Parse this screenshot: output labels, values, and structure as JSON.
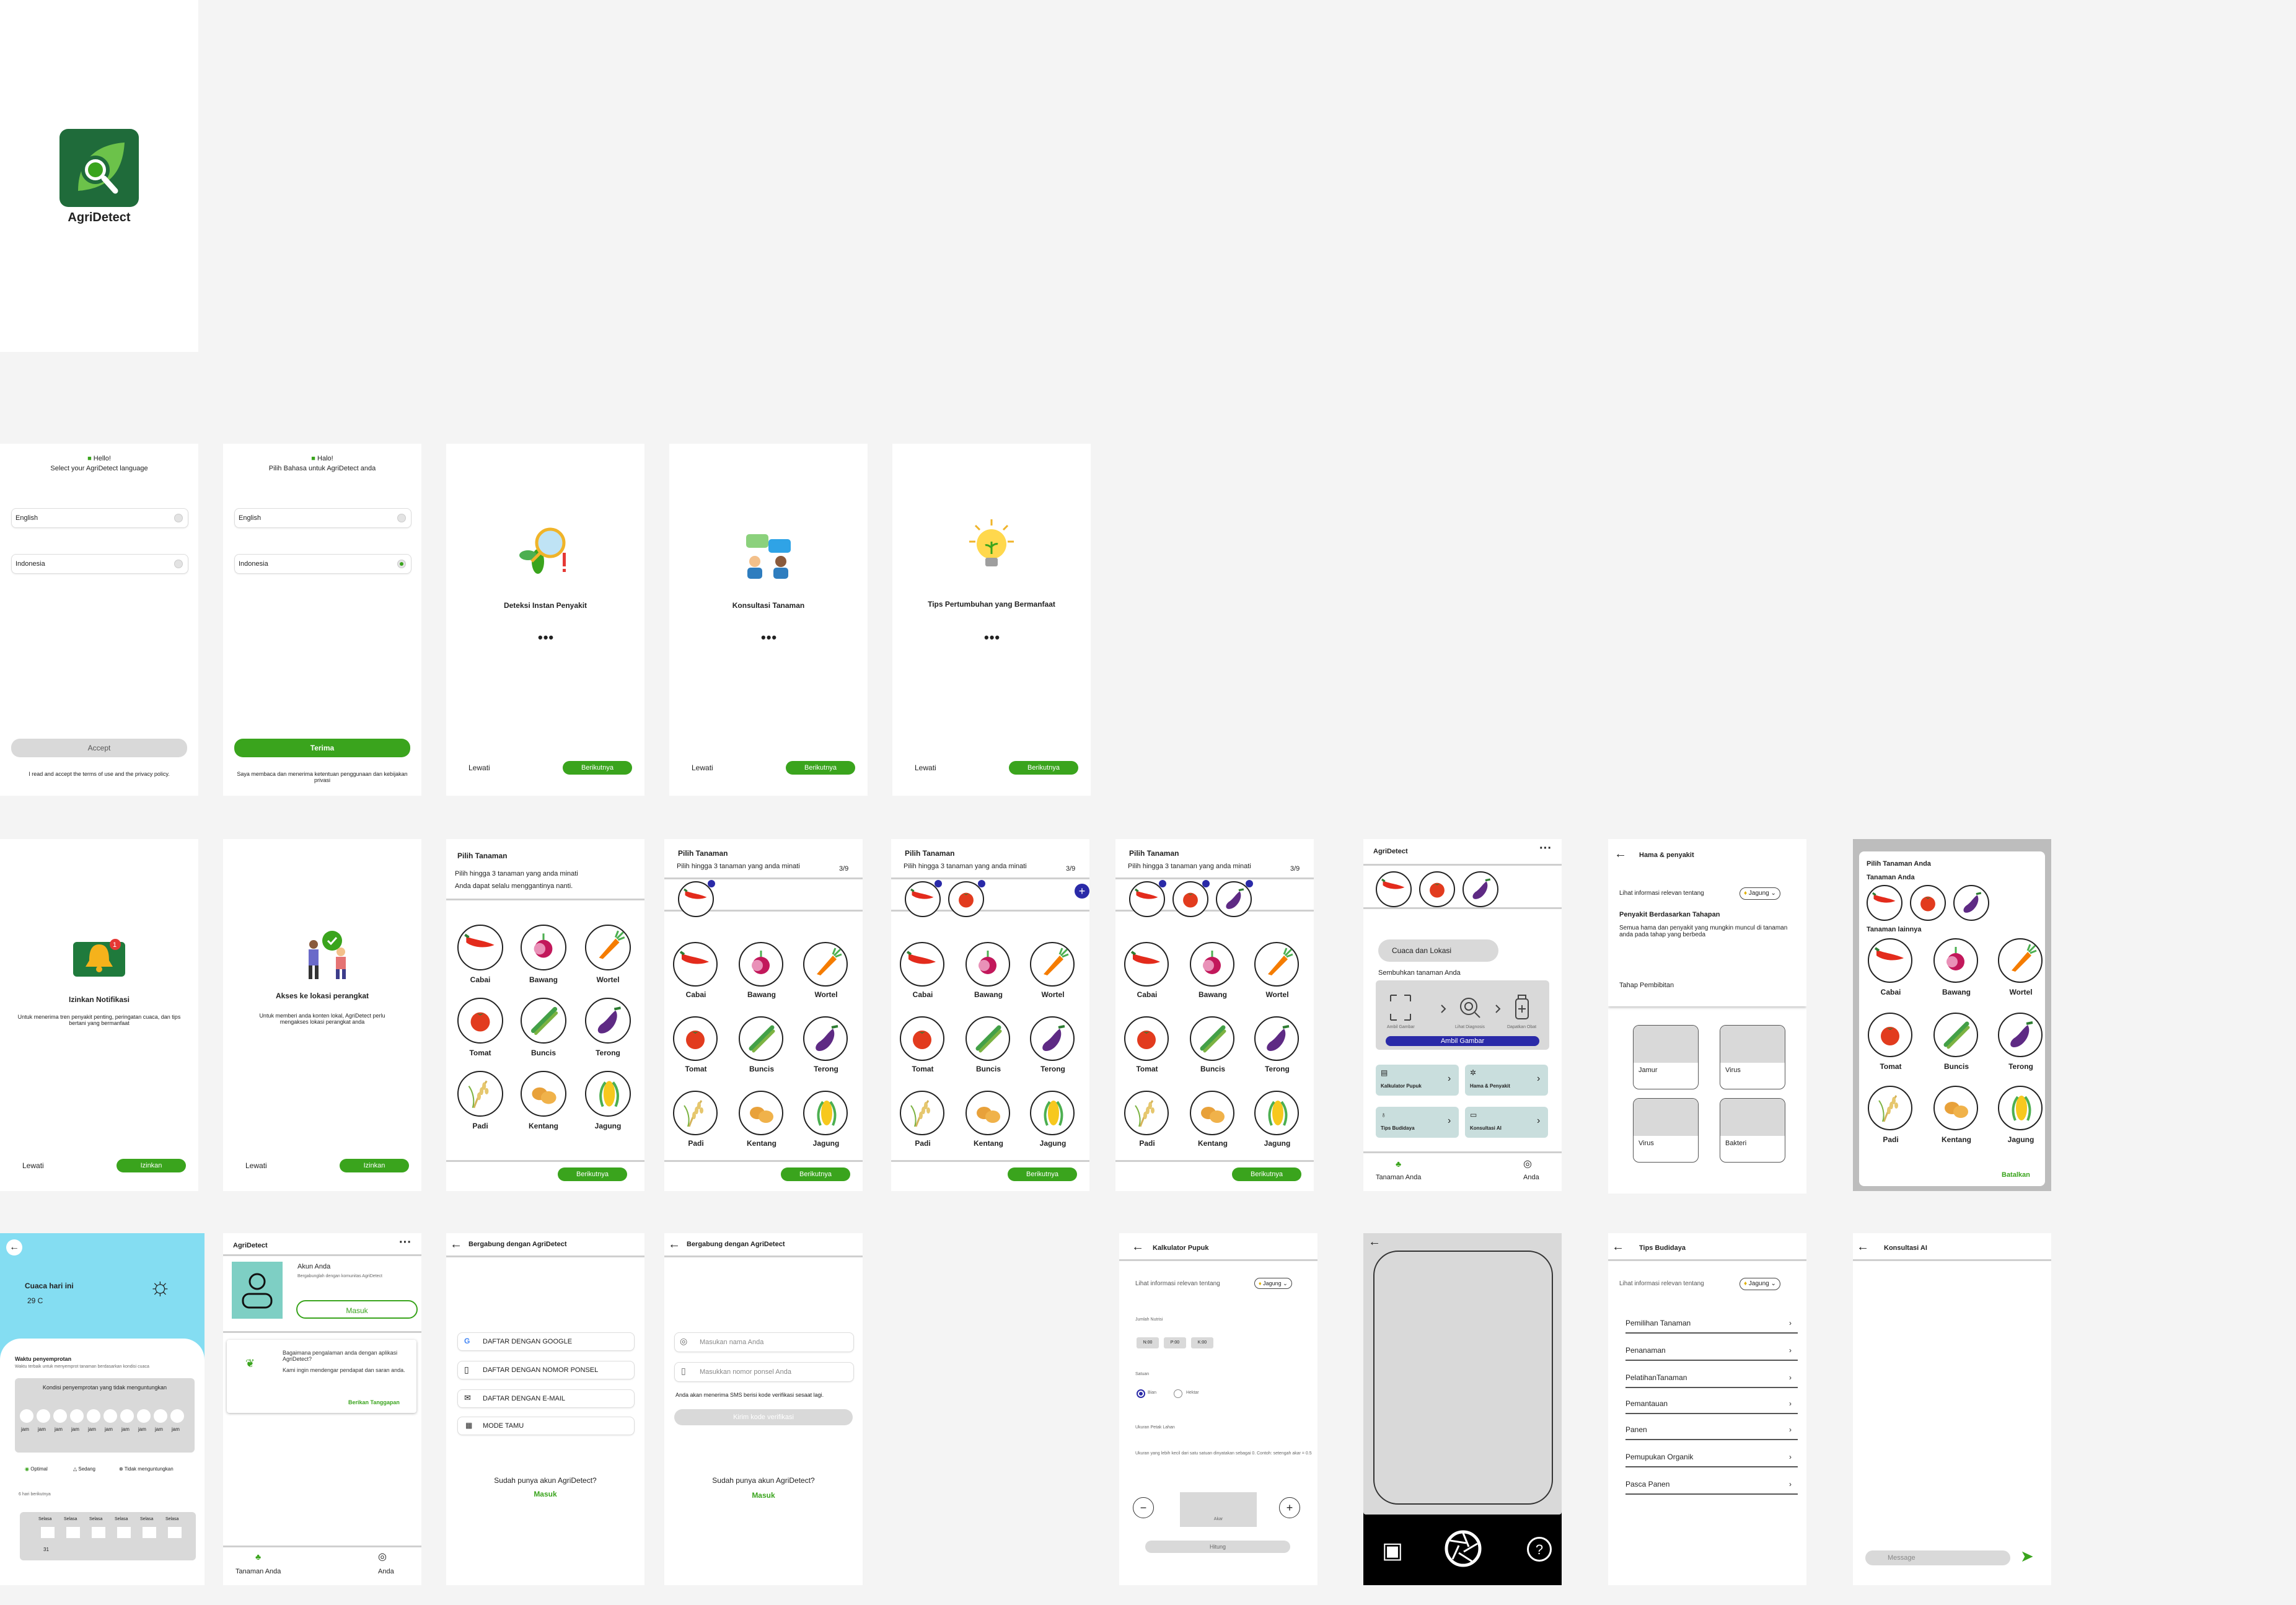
{
  "logo": {
    "app_name": "AgriDetect"
  },
  "lang_en": {
    "hello": "Hello!",
    "prompt": "Select your AgriDetect language",
    "opt1": "English",
    "opt2": "Indonesia",
    "accept": "Accept",
    "terms": "I read and accept the terms of use and the privacy policy."
  },
  "lang_id": {
    "hello": "Halo!",
    "prompt": "Pilih Bahasa untuk AgriDetect anda",
    "opt1": "English",
    "opt2": "Indonesia",
    "accept": "Terima",
    "terms": "Saya membaca dan menerima ketentuan penggunaan dan kebijakan privasi"
  },
  "onboard": [
    {
      "title": "Deteksi Instan Penyakit",
      "skip": "Lewati",
      "next": "Berikutnya"
    },
    {
      "title": "Konsultasi Tanaman",
      "skip": "Lewati",
      "next": "Berikutnya"
    },
    {
      "title": "Tips Pertumbuhan yang Bermanfaat",
      "skip": "Lewati",
      "next": "Berikutnya"
    }
  ],
  "notif": {
    "title": "Izinkan Notifikasi",
    "desc": "Untuk menerima tren penyakit penting, peringatan cuaca, dan tips bertani yang bermanfaat",
    "skip": "Lewati",
    "allow": "Izinkan"
  },
  "loc": {
    "title": "Akses ke lokasi perangkat",
    "desc": "Untuk memberi anda konten lokal, AgriDetect perlu mengakses lokasi perangkat anda",
    "skip": "Lewati",
    "allow": "Izinkan"
  },
  "pick": {
    "title": "Pilih Tanaman",
    "sub1": "Pilih hingga 3 tanaman yang anda minati",
    "sub2": "Anda dapat selalu menggantinya nanti.",
    "count": "3/9",
    "next": "Berikutnya",
    "veg": [
      "Cabai",
      "Bawang",
      "Wortel",
      "Tomat",
      "Buncis",
      "Terong",
      "Padi",
      "Kentang",
      "Jagung"
    ]
  },
  "home": {
    "title": "AgriDetect",
    "weather": "Cuaca dan Lokasi",
    "heal": "Sembuhkan tanaman Anda",
    "step1": "Ambil Gambar",
    "step2": "Lihat Diagnosis",
    "step3": "Dapatkan Obat",
    "take": "Ambil Gambar",
    "c1": "Kalkulator Pupuk",
    "c2": "Hama & Penyakit",
    "c3": "Tips Budidaya",
    "c4": "Konsultasi AI",
    "nav1": "Tanaman Anda",
    "nav2": "Anda"
  },
  "pest": {
    "title": "Hama & penyakit",
    "see": "Lihat informasi relevan tentang",
    "crop": "Jagung",
    "h": "Penyakit Berdasarkan Tahapan",
    "desc": "Semua hama dan penyakit yang mungkin muncul di tanaman anda pada tahap yang berbeda",
    "stage": "Tahap Pembibitan",
    "cards": [
      "Jamur",
      "Virus",
      "Virus",
      "Bakteri"
    ]
  },
  "modal": {
    "title": "Pilih Tanaman Anda",
    "mine": "Tanaman Anda",
    "other": "Tanaman lainnya",
    "cancel": "Batalkan"
  },
  "weather": {
    "title": "Cuaca hari ini",
    "temp": "29  C",
    "spray": "Waktu penyemprotan",
    "spray_desc": "Waktu terbaik untuk menyemprot tanaman berdasarkan kondisi cuaca",
    "cond": "Kondisi penyemprotan yang tidak menguntungkan",
    "hour": "jam",
    "lg1": "Optimal",
    "lg2": "Sedang",
    "lg3": "Tidak menguntungkan",
    "next6": "6 hari berikutnya",
    "day": "Selasa",
    "d31": "31"
  },
  "account": {
    "title": "AgriDetect",
    "acc": "Akun Anda",
    "join": "Bergabunglah dengan komunitas AgriDetect",
    "login": "Masuk",
    "q": "Bagaimana pengalaman anda dengan aplikasi AgriDetect?",
    "fb": "Kami ingin mendengar pendapat dan saran anda.",
    "give": "Berikan Tanggapan",
    "nav1": "Tanaman Anda",
    "nav2": "Anda"
  },
  "join": {
    "title": "Bergabung dengan AgriDetect",
    "g": "DAFTAR DENGAN GOOGLE",
    "p": "DAFTAR DENGAN NOMOR PONSEL",
    "e": "DAFTAR DENGAN E-MAIL",
    "m": "MODE TAMU",
    "have": "Sudah punya akun AgriDetect?",
    "login": "Masuk"
  },
  "join2": {
    "title": "Bergabung dengan AgriDetect",
    "name": "Masukan nama Anda",
    "phone": "Masukkan nomor ponsel Anda",
    "sms": "Anda akan menerima SMS berisi kode verifikasi sesaat lagi.",
    "send": "Kirim kode verifikasi",
    "have": "Sudah punya akun AgriDetect?",
    "login": "Masuk"
  },
  "calc": {
    "title": "Kalkulator Pupuk",
    "see": "Lihat informasi relevan tentang",
    "crop": "Jagung",
    "nut": "Jumlah Nutrisi",
    "chips": [
      "N:00",
      "P:00",
      "K:00"
    ],
    "unit": "Satuan",
    "u1": "Bian",
    "u2": "Hektar",
    "size": "Ukuran Petak Lahan",
    "size_desc": "Ukuran yang lebih kecil dari satu satuan dinyatakan sebagai 0. Contoh: setengah akar = 0.5",
    "val": "Akar",
    "calc": "Hitung"
  },
  "tips": {
    "title": "Tips Budidaya",
    "see": "Lihat informasi relevan tentang",
    "crop": "Jagung",
    "items": [
      "Pemilihan Tanaman",
      "Penanaman",
      "PelatihanTanaman",
      "Pemantauan",
      "Panen",
      "Pemupukan Organik",
      "Pasca Panen"
    ]
  },
  "ai": {
    "title": "Konsultasi AI",
    "msg": "Message"
  }
}
